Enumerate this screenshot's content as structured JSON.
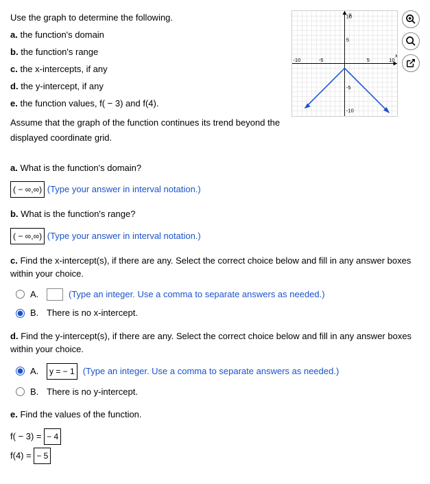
{
  "intro": {
    "header": "Use the graph to determine the following.",
    "a": "the function's domain",
    "b": "the function's range",
    "c": "the x-intercepts, if any",
    "d": "the y-intercept, if any",
    "e": "the function values, f( − 3) and f(4).",
    "footer": "Assume that the graph of the function continues its trend beyond the displayed coordinate grid."
  },
  "graph": {
    "axis_labels": {
      "x": "x",
      "y": "y"
    },
    "ticks": {
      "xmin": "-10",
      "xneg": "-5",
      "xpos": "5",
      "xmax": "10",
      "ymax": "10",
      "ypos": "5",
      "yneg": "-5",
      "ymin": "-10"
    }
  },
  "tools": {
    "zoom_in": "search-plus",
    "zoom_out": "search",
    "popout": "external"
  },
  "qa": {
    "a_prompt": "a. What is the function's domain?",
    "a_answer": "( − ∞,∞)",
    "a_hint": "(Type your answer in interval notation.)",
    "b_prompt": "b. What is the function's range?",
    "b_answer": "( − ∞,∞)",
    "b_hint": "(Type your answer in interval notation.)",
    "c_prompt": "c. Find the x-intercept(s), if there are any. Select the correct choice below and fill in any answer boxes within your choice.",
    "c_A_hint": "(Type an integer. Use a comma to separate answers as needed.)",
    "c_B_text": "There is no x-intercept.",
    "d_prompt": "d. Find the y-intercept(s), if there are any. Select the correct choice below and fill in any answer boxes within your choice.",
    "d_A_answer": "y = − 1",
    "d_A_hint": "(Type an integer. Use a comma to separate answers as needed.)",
    "d_B_text": "There is no y-intercept.",
    "e_prompt": "e. Find the values of the function.",
    "e_f1_lhs": "f( − 3) = ",
    "e_f1_ans": "− 4",
    "e_f2_lhs": "f(4) = ",
    "e_f2_ans": "− 5",
    "letter_A": "A.",
    "letter_B": "B."
  },
  "chart_data": {
    "type": "line",
    "title": "",
    "xlabel": "x",
    "ylabel": "y",
    "xlim": [
      -10,
      10
    ],
    "ylim": [
      -10,
      10
    ],
    "series": [
      {
        "name": "f",
        "points": [
          [
            -8,
            -9
          ],
          [
            -3,
            -4
          ],
          [
            0,
            -1
          ],
          [
            4,
            -5
          ],
          [
            9,
            -10
          ]
        ]
      }
    ],
    "ticks_x": [
      -10,
      -5,
      5,
      10
    ],
    "ticks_y": [
      -10,
      -5,
      5,
      10
    ]
  }
}
